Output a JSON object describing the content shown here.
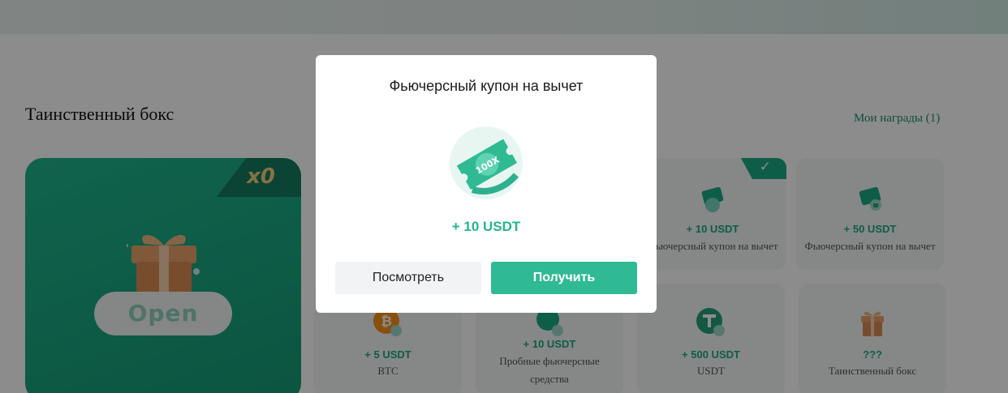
{
  "section": {
    "title": "Таинственный бокс",
    "my_rewards": "Мои награды (1)"
  },
  "big_box": {
    "count": "x0",
    "open_label": "Open"
  },
  "cards": [
    {
      "amount": "+ 10 USDT",
      "label": "Фьючерсный купон на вычет",
      "claimed": true,
      "icon": "coupon-icon"
    },
    {
      "amount": "+ 50 USDT",
      "label": "Фьючерсный купон на вычет",
      "claimed": false,
      "icon": "coupon-locked-icon"
    },
    {
      "amount": "+ 5 USDT",
      "label": "BTC",
      "claimed": false,
      "icon": "btc-icon"
    },
    {
      "amount": "+ 10 USDT",
      "label": "Пробные фьючерсные средства",
      "claimed": false,
      "icon": "trial-funds-icon"
    },
    {
      "amount": "+ 500 USDT",
      "label": "USDT",
      "claimed": false,
      "icon": "usdt-icon"
    },
    {
      "amount": "???",
      "label": "Таинственный бокс",
      "claimed": false,
      "icon": "gift-icon"
    }
  ],
  "modal": {
    "title": "Фьючерсный купон на вычет",
    "coupon_text": "100X",
    "amount": "+ 10 USDT",
    "view_label": "Посмотреть",
    "get_label": "Получить"
  },
  "colors": {
    "accent": "#2fba93",
    "amount_green": "#1aa984",
    "btc_orange": "#f7931a",
    "usdt_green": "#26a17b",
    "box_orange": "#e9a36a"
  }
}
